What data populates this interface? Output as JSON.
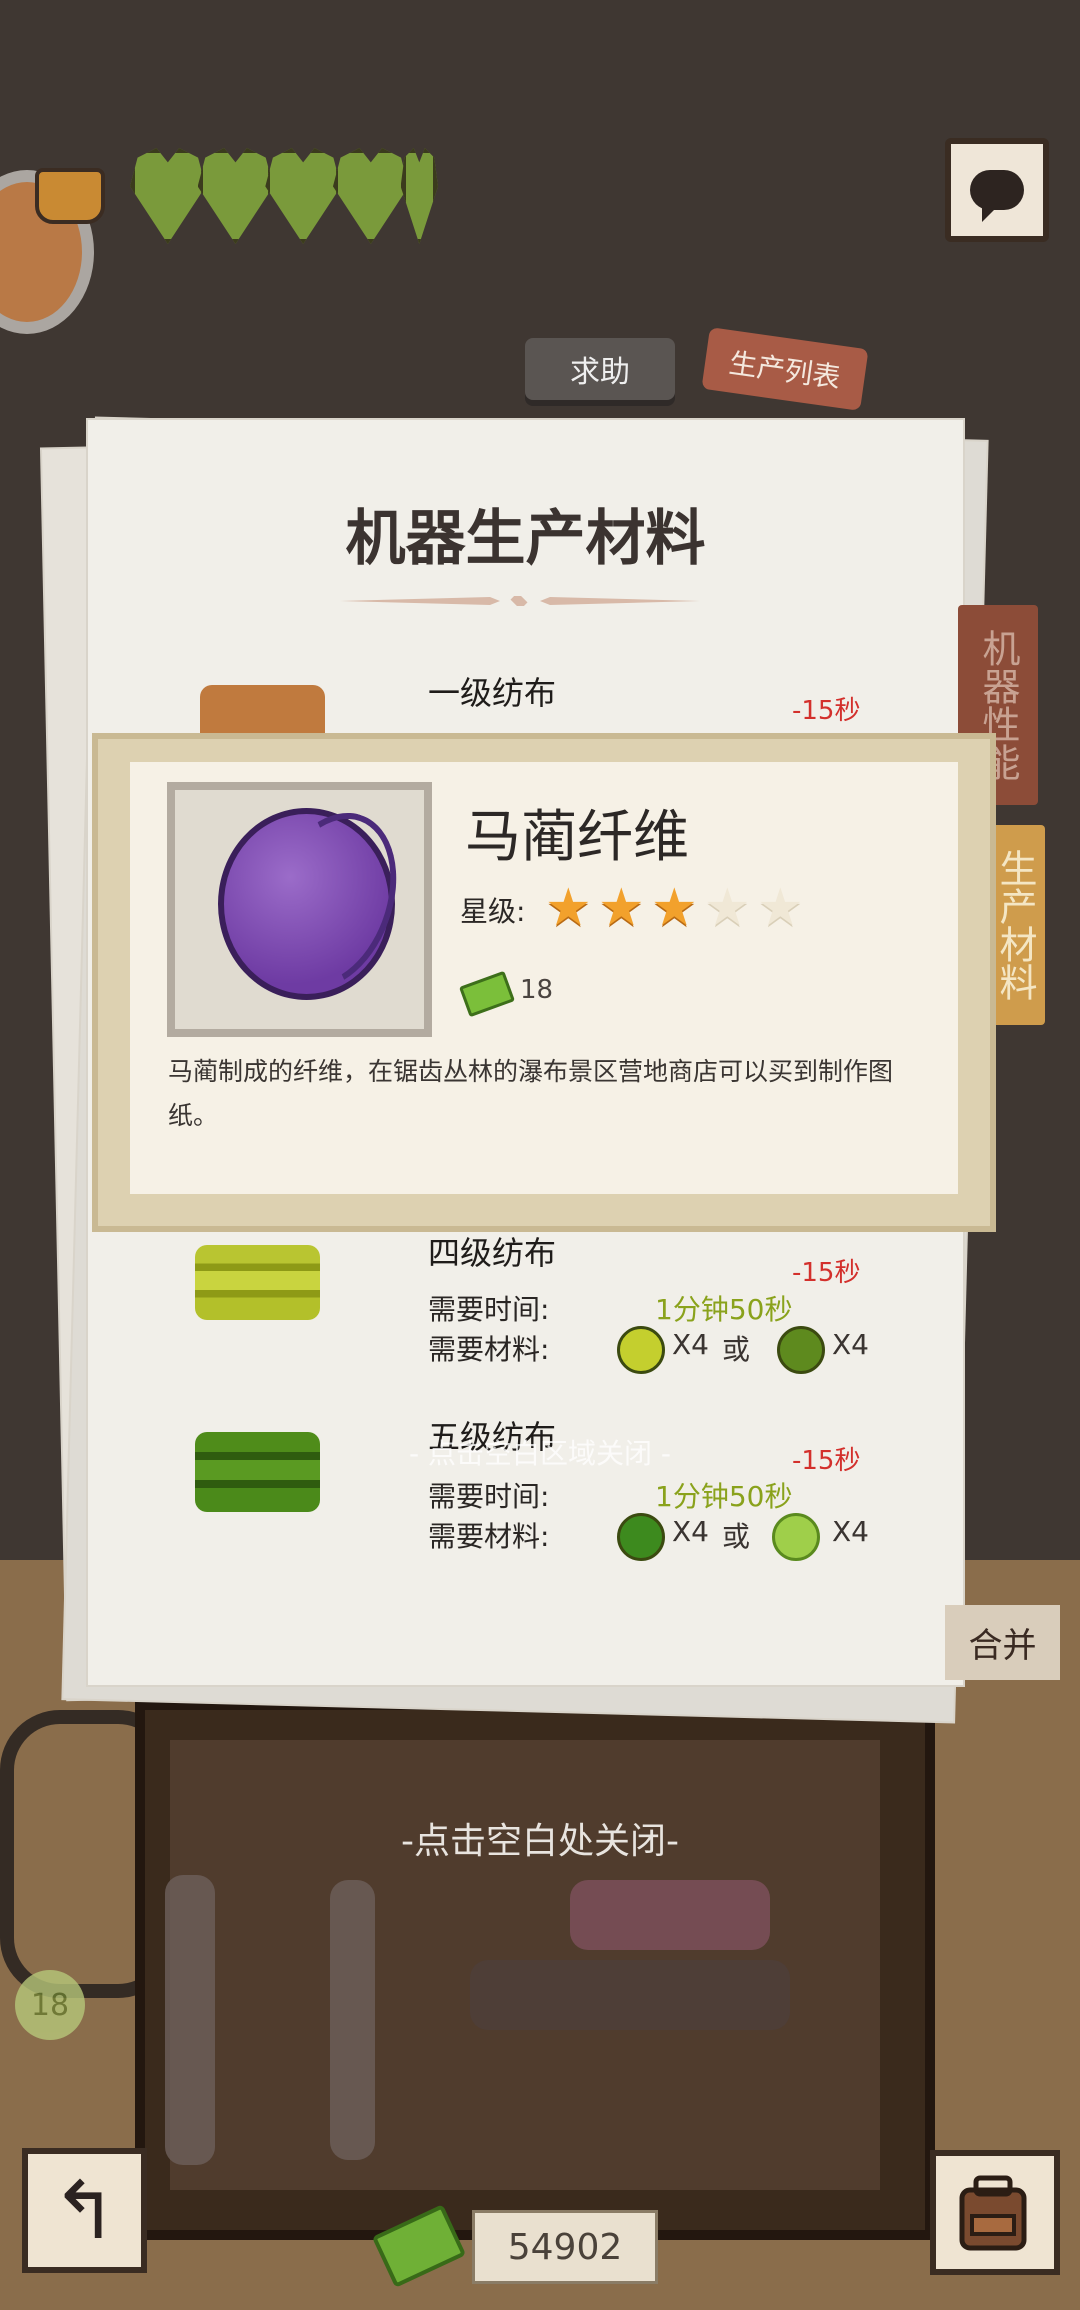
{
  "hud": {
    "hearts": 5,
    "chat_icon": "chat-icon"
  },
  "tabs": {
    "help": "求助",
    "production_list": "生产列表"
  },
  "panel": {
    "title": "机器生产材料",
    "side_tab_machine": "机器性能",
    "side_tab_materials": "生产材料",
    "rows": [
      {
        "name": "一级纺布",
        "timer": "-15秒"
      },
      {
        "name": "四级纺布",
        "timer": "-15秒",
        "time_label": "需要时间:",
        "time": "1分钟50秒",
        "material_label": "需要材料:",
        "qty_a": "X4",
        "or": "或",
        "qty_b": "X4"
      },
      {
        "name": "五级纺布",
        "timer": "-15秒",
        "time_label": "需要时间:",
        "time": "1分钟50秒",
        "material_label": "需要材料:",
        "qty_a": "X4",
        "or": "或",
        "qty_b": "X4"
      }
    ],
    "close_hint_small": "- 点击空白区域关闭 -"
  },
  "popup": {
    "item_name": "马蔺纤维",
    "star_label": "星级:",
    "stars_filled": 3,
    "stars_total": 5,
    "price": "18",
    "description": "马蔺制成的纤维，在锯齿丛林的瀑布景区营地商店可以买到制作图纸。"
  },
  "bottom": {
    "close_hint": "-点击空白处关闭-",
    "merge": "合并",
    "money": "54902",
    "level": "18"
  },
  "colors": {
    "star_on": "#f2a12c",
    "timer_red": "#d3302c",
    "time_green": "#8aa21c"
  }
}
